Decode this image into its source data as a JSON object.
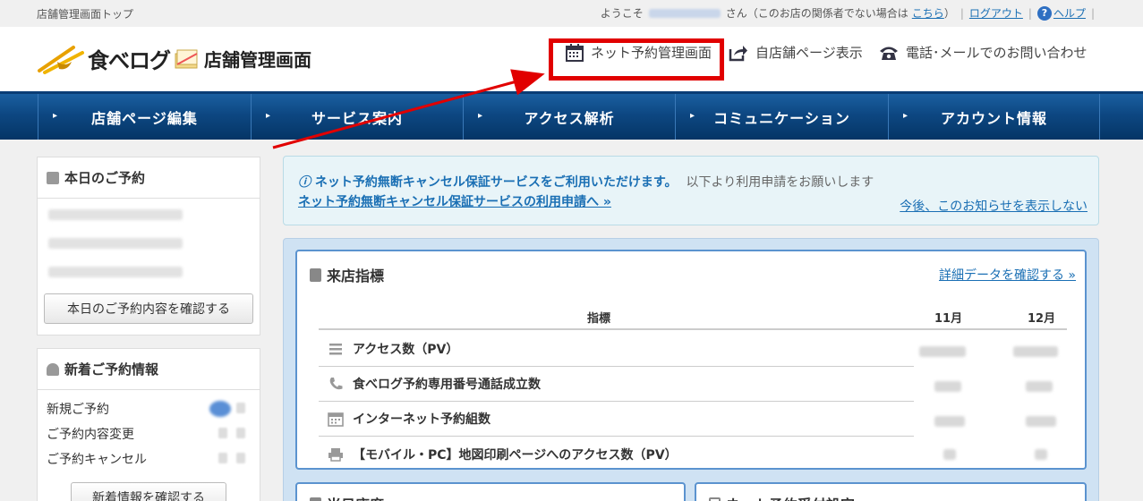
{
  "topbar": {
    "breadcrumb": "店舗管理画面トップ",
    "welcome_prefix": "ようこそ",
    "welcome_suffix": "さん（このお店の関係者でない場合は",
    "here_link": "こちら",
    "close_paren": "）",
    "logout": "ログアウト",
    "help": "ヘルプ"
  },
  "header": {
    "logo_main": "食べログ",
    "logo_sub": "店舗管理画面",
    "links": [
      {
        "label": "ネット予約管理画面",
        "icon": "calendar-icon"
      },
      {
        "label": "自店舗ページ表示",
        "icon": "share-icon"
      },
      {
        "label": "電話･メールでのお問い合わせ",
        "icon": "phone-icon"
      }
    ]
  },
  "nav": {
    "items": [
      "店舗ページ編集",
      "サービス案内",
      "アクセス解析",
      "コミュニケーション",
      "アカウント情報"
    ]
  },
  "sidebar": {
    "today": {
      "title": "本日のご予約",
      "button": "本日のご予約内容を確認する"
    },
    "news": {
      "title": "新着ご予約情報",
      "items": [
        "新規ご予約",
        "ご予約内容変更",
        "ご予約キャンセル"
      ],
      "button": "新着情報を確認する"
    }
  },
  "notice": {
    "headline": "ネット予約無断キャンセル保証サービスをご利用いただけます。",
    "sub": "以下より利用申請をお願いします",
    "apply_link": "ネット予約無断キャンセル保証サービスの利用申請へ »",
    "hide_link": "今後、このお知らせを表示しない"
  },
  "metrics": {
    "title": "来店指標",
    "detail_link": "詳細データを確認する »",
    "col_indicator": "指標",
    "col_m1": "11月",
    "col_m2": "12月",
    "rows": [
      {
        "label": "アクセス数（PV）",
        "icon": "list-icon"
      },
      {
        "label": "食べログ予約専用番号通話成立数",
        "icon": "phone-icon"
      },
      {
        "label": "インターネット予約組数",
        "icon": "calendar-icon"
      },
      {
        "label": "【モバイル・PC】地図印刷ページへのアクセス数（PV）",
        "icon": "printer-icon"
      }
    ]
  },
  "bottom_cards": {
    "left_title": "当日座席",
    "right_title": "ネット予約受付設定"
  },
  "colors": {
    "nav_blue": "#0d4782",
    "link_blue": "#1a6fb4",
    "highlight_red": "#e10000"
  }
}
